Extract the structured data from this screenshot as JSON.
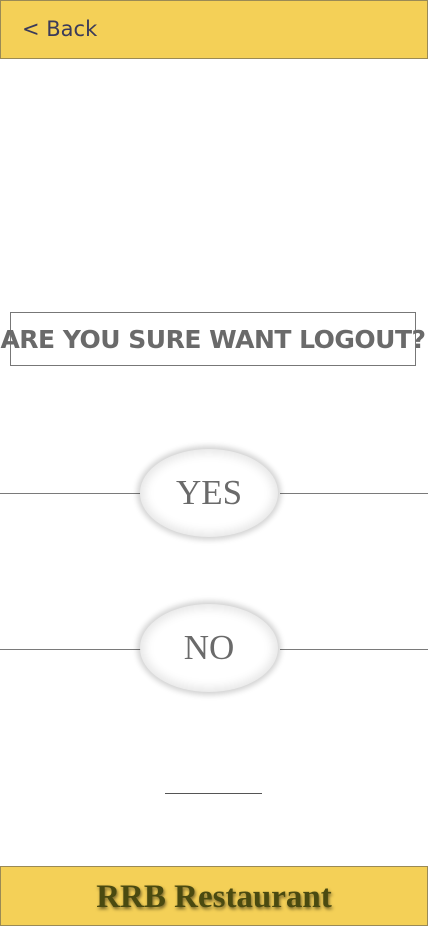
{
  "header": {
    "back_label": "< Back",
    "background_color": "#f4d057"
  },
  "dialog": {
    "question": "Are you sure want logout?"
  },
  "actions": {
    "yes_label": "YES",
    "no_label": "NO"
  },
  "footer": {
    "title": "RRB Restaurant",
    "background_color": "#f4d057"
  }
}
